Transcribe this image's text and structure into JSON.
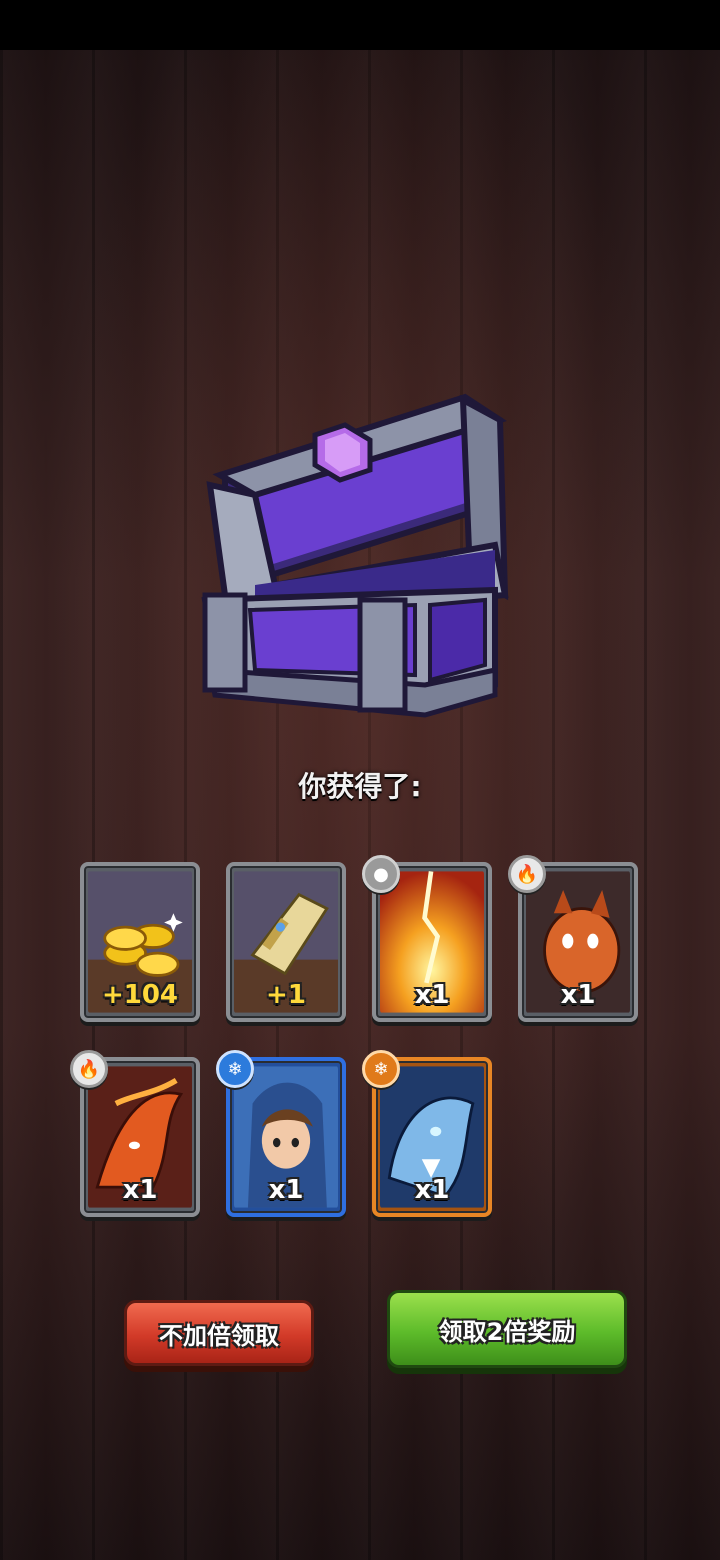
{
  "reward_title": "你获得了:",
  "rewards": [
    {
      "name": "gold-coins",
      "count": "+104",
      "element": null
    },
    {
      "name": "scroll",
      "count": "+1",
      "element": null
    },
    {
      "name": "lightning-strike",
      "count": "x1",
      "element": "stone-icon"
    },
    {
      "name": "orange-dragon",
      "count": "x1",
      "element": "fire-icon"
    },
    {
      "name": "fire-fox",
      "count": "x1",
      "element": "fire-icon"
    },
    {
      "name": "ice-mage",
      "count": "x1",
      "element": "snowflake-icon"
    },
    {
      "name": "ice-dragon",
      "count": "x1",
      "element": "snowflake-icon"
    }
  ],
  "buttons": {
    "no_double": "不加倍领取",
    "double": "领取2倍奖励"
  },
  "colors": {
    "no_double_button": "#d23a28",
    "double_button": "#5dbb2a",
    "card_frame_gray": "#8b8e93",
    "card_frame_blue": "#2f6fe0",
    "card_frame_orange": "#e88625"
  }
}
